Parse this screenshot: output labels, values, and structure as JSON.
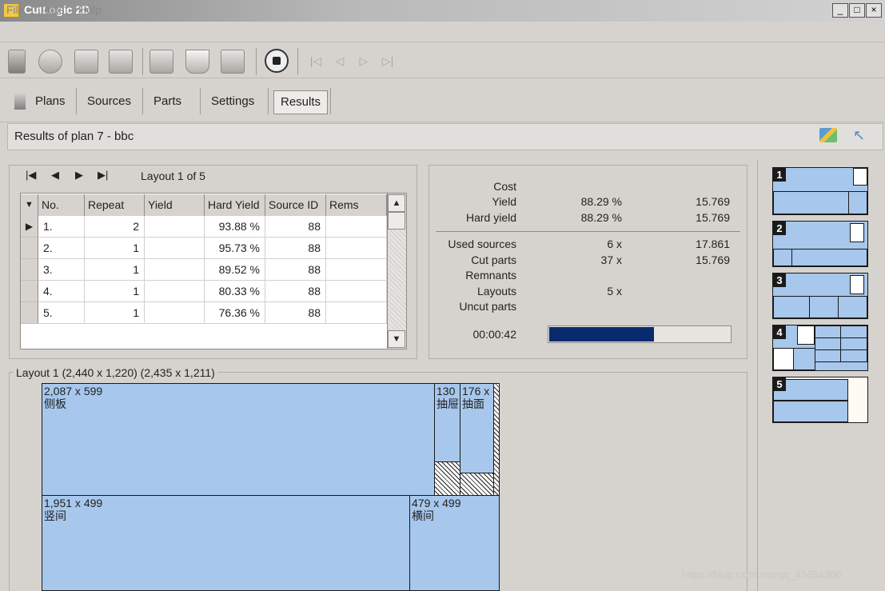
{
  "window": {
    "title": "CutLogic 2D",
    "min": "_",
    "max": "□",
    "close": "×"
  },
  "menu": [
    "File",
    "Tools",
    "Help"
  ],
  "toolbar": {
    "tools": [
      "plans-tool-icon",
      "sources-tool-icon",
      "parts-tool-icon",
      "optimize-tool-icon",
      "print-tool-icon",
      "filter-tool-icon",
      "export-tool-icon",
      "stop-icon"
    ],
    "nav": [
      "|◁",
      "◁",
      "▷",
      "▷|"
    ]
  },
  "tabs": [
    "Plans",
    "Sources",
    "Parts",
    "Settings",
    "Results"
  ],
  "header": {
    "title": "Results of plan 7 - bbc"
  },
  "layouts_grid": {
    "nav": [
      "|◀",
      "◀",
      "▶",
      "▶|"
    ],
    "caption": "Layout 1 of 5",
    "columns": [
      "No.",
      "Repeat",
      "Yield",
      "Hard Yield",
      "Source ID",
      "Rems"
    ],
    "rows": [
      {
        "no": "1.",
        "repeat": "2",
        "yield": "",
        "hard_yield": "93.88 %",
        "source_id": "88",
        "rems": ""
      },
      {
        "no": "2.",
        "repeat": "1",
        "yield": "",
        "hard_yield": "95.73 %",
        "source_id": "88",
        "rems": ""
      },
      {
        "no": "3.",
        "repeat": "1",
        "yield": "",
        "hard_yield": "89.52 %",
        "source_id": "88",
        "rems": ""
      },
      {
        "no": "4.",
        "repeat": "1",
        "yield": "",
        "hard_yield": "80.33 %",
        "source_id": "88",
        "rems": ""
      },
      {
        "no": "5.",
        "repeat": "1",
        "yield": "",
        "hard_yield": "76.36 %",
        "source_id": "88",
        "rems": ""
      }
    ]
  },
  "stats": {
    "cost": {
      "label": "Cost",
      "value": "",
      "value2": ""
    },
    "yield": {
      "label": "Yield",
      "value": "88.29 %",
      "value2": "15.769"
    },
    "hard_yield": {
      "label": "Hard yield",
      "value": "88.29 %",
      "value2": "15.769"
    },
    "used_sources": {
      "label": "Used sources",
      "value": "6 x",
      "value2": "17.861"
    },
    "cut_parts": {
      "label": "Cut parts",
      "value": "37 x",
      "value2": "15.769"
    },
    "remnants": {
      "label": "Remnants",
      "value": "",
      "value2": ""
    },
    "layouts": {
      "label": "Layouts",
      "value": "5 x",
      "value2": ""
    },
    "uncut_parts": {
      "label": "Uncut parts",
      "value": "",
      "value2": ""
    },
    "time": "00:00:42",
    "progress": 0.58
  },
  "layout": {
    "title": "Layout 1  (2,440 x 1,220)  (2,435 x 1,211)",
    "pieces": [
      {
        "size": "2,087 x 599",
        "name": "侧板"
      },
      {
        "size": "130",
        "name": "抽屉"
      },
      {
        "size": "176 x",
        "name": "抽面"
      },
      {
        "size": "1,951 x 499",
        "name": "竖间"
      },
      {
        "size": "479 x 499",
        "name": "横间"
      }
    ]
  },
  "thumbnails": [
    "1",
    "2",
    "3",
    "4",
    "5"
  ],
  "watermark": "https://blog.csdn.net/qq_45654306",
  "colors": {
    "piece": "#a7c7ec",
    "progress": "#0a2a6e",
    "waste": "#ffffff"
  }
}
